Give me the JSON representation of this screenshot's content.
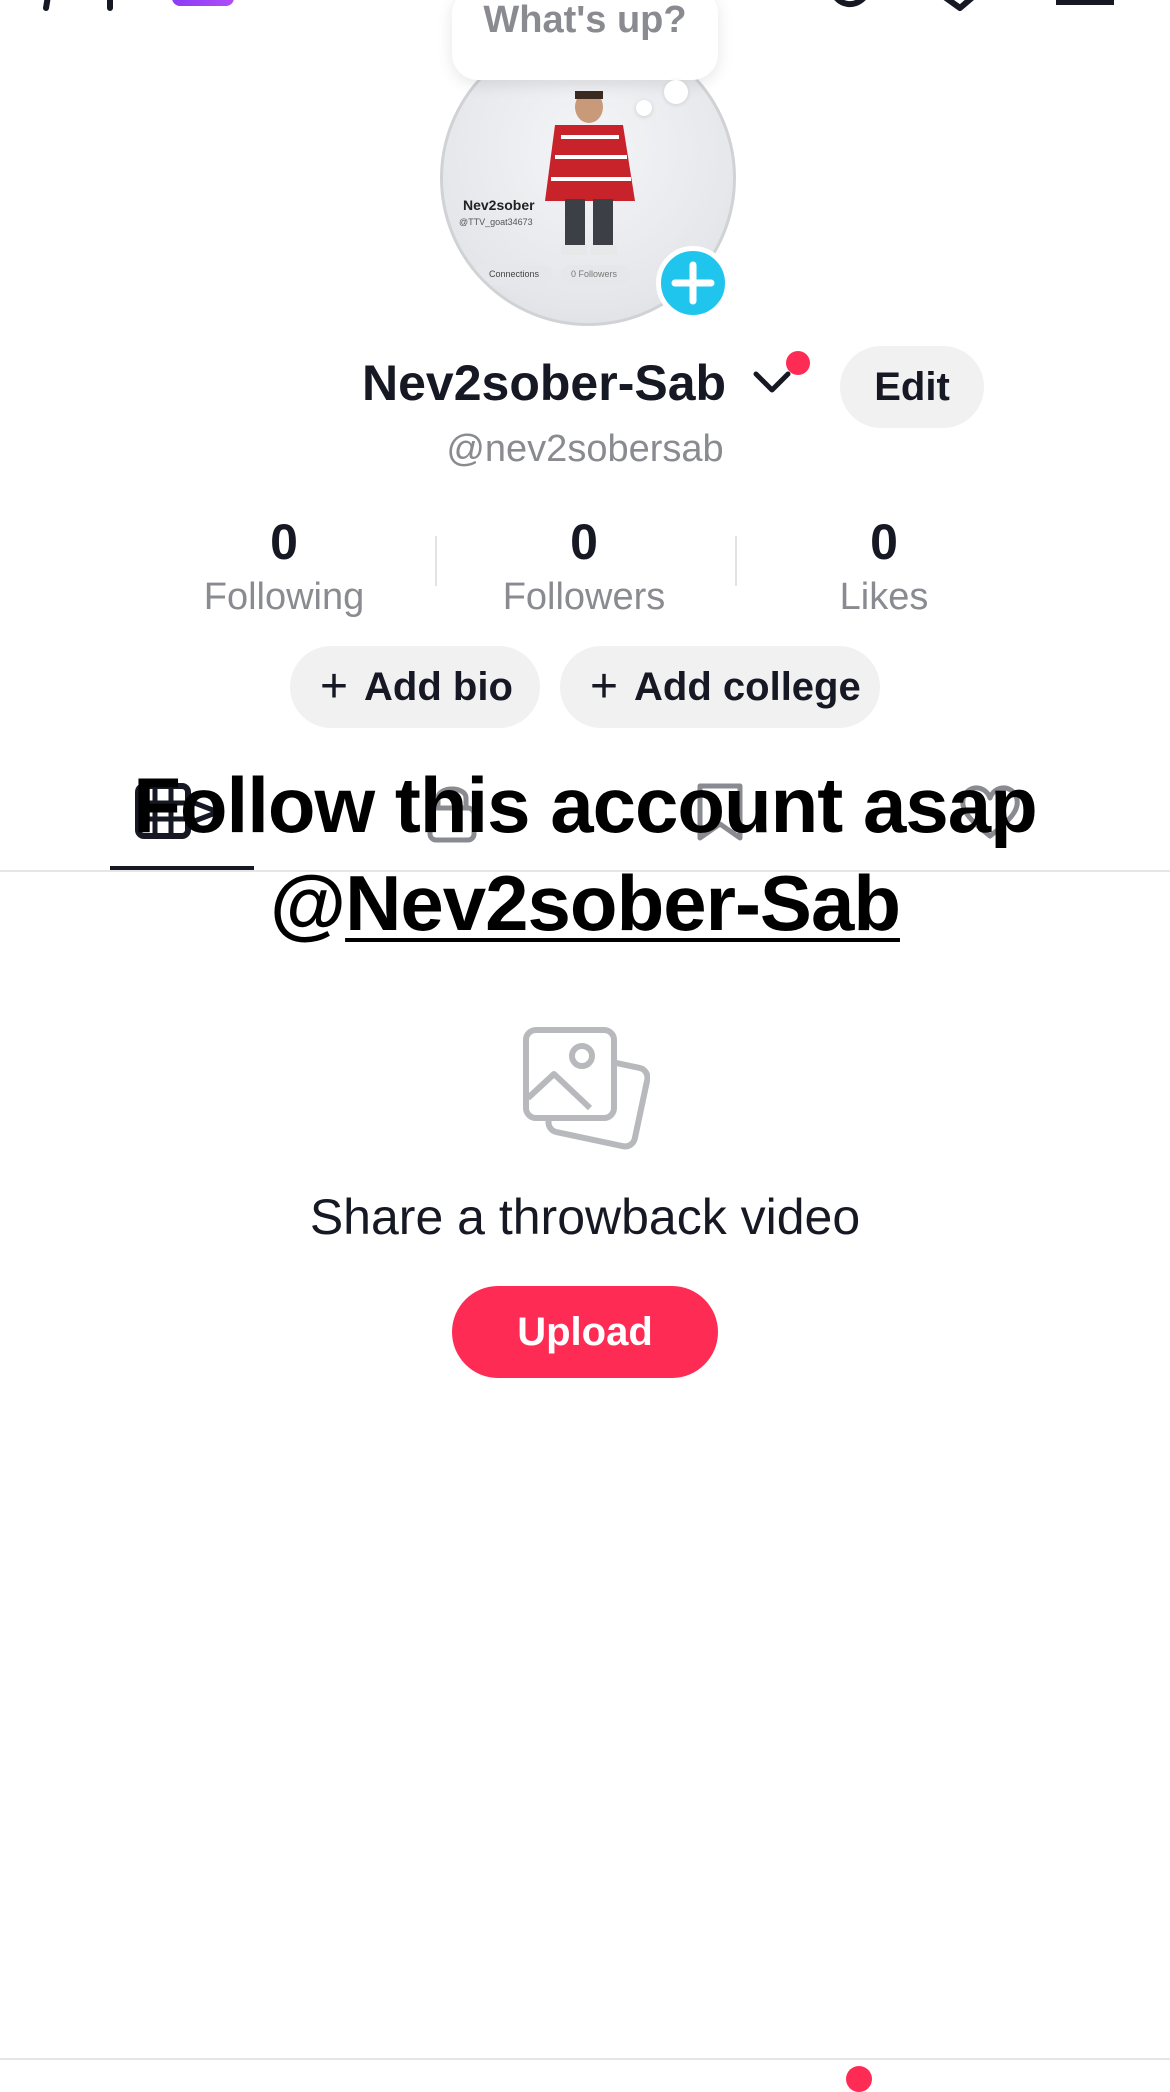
{
  "speech_bubble": {
    "text": "What's up?"
  },
  "profile": {
    "display_name": "Nev2sober-Sab",
    "handle": "@nev2sobersab",
    "edit_label": "Edit",
    "avatar_caption_name": "Nev2sober",
    "avatar_caption_handle": "@TTV_goat34673",
    "avatar_caption_connections": "Connections",
    "avatar_caption_followers": "0 Followers"
  },
  "stats": [
    {
      "value": "0",
      "label": "Following"
    },
    {
      "value": "0",
      "label": "Followers"
    },
    {
      "value": "0",
      "label": "Likes"
    }
  ],
  "actions": {
    "add_bio": "Add bio",
    "add_college": "Add college"
  },
  "overlay_text": {
    "line1": "Follow this account asap",
    "line2_prefix": "@",
    "line2_link": "Nev2sober-Sab"
  },
  "empty_state": {
    "icon": "photo-stack-icon",
    "message": "Share a throwback video",
    "upload_label": "Upload"
  },
  "tabs": [
    "videos-grid-icon",
    "lock-icon",
    "bookmark-icon",
    "heart-icon"
  ],
  "colors": {
    "accent": "#fe2c55",
    "avatar_add": "#20c5ee",
    "muted_text": "#8a8b91"
  }
}
